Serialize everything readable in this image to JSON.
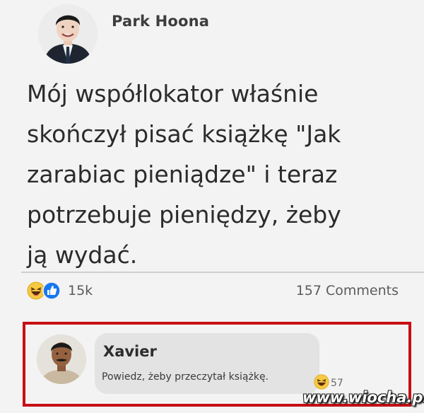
{
  "post": {
    "author": "Park Hoona",
    "text": "Mój współlokator właśnie\nskończył pisać książkę \"Jak\nzarabiac pieniądze\" i teraz\npotrzebuje pieniędzy, żeby\nją wydać.",
    "reactions": {
      "icons": [
        "haha-reaction-icon",
        "like-reaction-icon"
      ],
      "count": "15k"
    },
    "comments_count": "157 Comments"
  },
  "comment": {
    "author": "Xavier",
    "text": "Powiedz, żeby przeczytał książkę.",
    "reaction_icon": "haha-reaction-icon",
    "reaction_count_partial": "57",
    "highlight_color": "#c70f14"
  },
  "watermark": {
    "text": "www.wiocha.pl"
  },
  "colors": {
    "like_blue": "#1877f2",
    "haha_yellow": "#f7c843"
  }
}
